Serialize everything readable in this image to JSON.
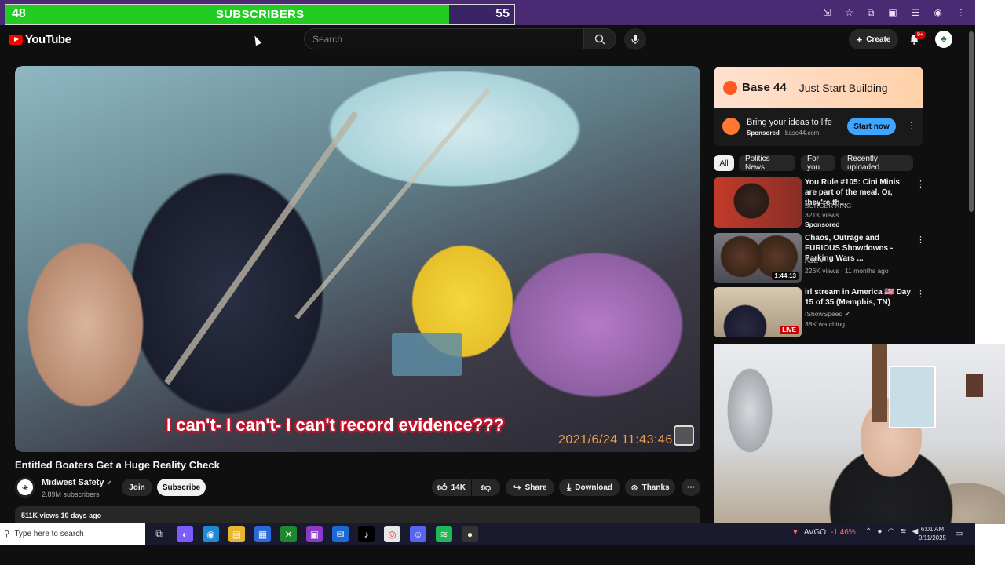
{
  "sub_counter": {
    "current": "48",
    "label": "SUBSCRIBERS",
    "goal": "55",
    "progress_fraction": 0.872
  },
  "header": {
    "logo_text": "YouTube",
    "search_placeholder": "Search",
    "create_label": "Create",
    "notif_badge": "9+"
  },
  "video": {
    "caption": "I can't- I can't- I can't record evidence???",
    "timestamp": "2021/6/24   11:43:46",
    "title": "Entitled Boaters Get a Huge Reality Check",
    "channel": "Midwest Safety",
    "subscribers": "2.89M subscribers",
    "join_label": "Join",
    "subscribe_label": "Subscribe",
    "likes": "14K",
    "share_label": "Share",
    "download_label": "Download",
    "thanks_label": "Thanks",
    "views_line": "511K views  10 days ago"
  },
  "ad": {
    "brand": "Base 44",
    "tagline": "Just Start Building",
    "headline": "Bring your ideas to life",
    "sponsored": "Sponsored",
    "domain": "base44.com",
    "cta": "Start now"
  },
  "chips": [
    "All",
    "Politics News",
    "For you",
    "Recently uploaded"
  ],
  "recommended": [
    {
      "title": "You Rule #105: Cini Minis are part of the meal. Or, they're th...",
      "channel": "BURGER KING",
      "meta": "321K views",
      "extra": "Sponsored",
      "duration": ""
    },
    {
      "title": "Chaos, Outrage and FURIOUS Showdowns - Parking Wars ...",
      "channel": "A&E",
      "meta": "226K views · 11 months ago",
      "extra": "",
      "duration": "1:44:13"
    },
    {
      "title": "irl stream in America 🇺🇸 Day 15 of 35 (Memphis, TN)",
      "channel": "IShowSpeed",
      "meta": "38K watching",
      "extra": "",
      "duration": "LIVE"
    }
  ],
  "taskbar": {
    "search_placeholder": "Type here to search",
    "stock_symbol": "AVGO",
    "stock_change": "-1.46%",
    "time": "6:01 AM",
    "date": "9/11/2025"
  },
  "colors": {
    "sub_fill": "#22cc22",
    "sub_bg": "#3a2466",
    "yt_red": "#ff0000",
    "cta_blue": "#3ea6ff",
    "caption_outline": "#c0142c"
  }
}
